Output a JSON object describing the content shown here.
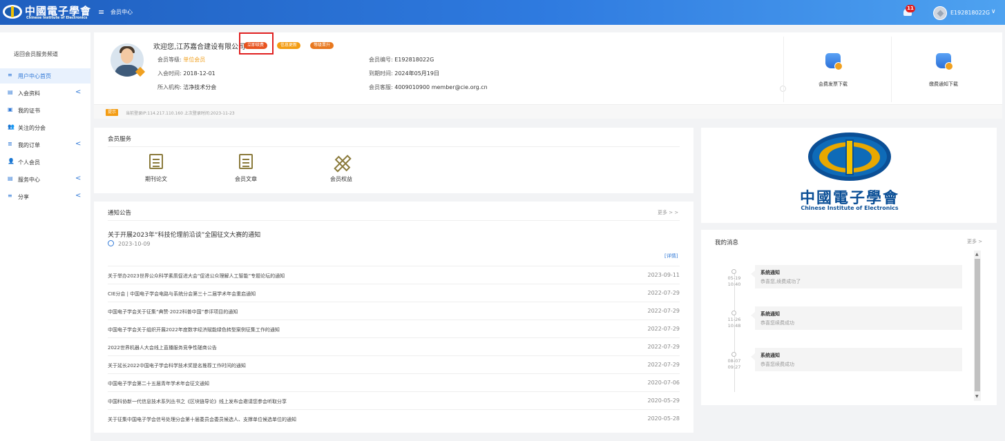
{
  "topbar": {
    "logo_cn": "中國電子學會",
    "logo_en": "Chinese Institute of Electronics",
    "menu_glyph": "≡",
    "breadcrumb": "会员中心",
    "notification_count": "11",
    "user_id": "E192818022G",
    "caret": "∨"
  },
  "sidebar": {
    "back_label": "返回会员服务频道",
    "items": [
      {
        "label": "用户中心首页",
        "icon": "≡",
        "active": true
      },
      {
        "label": "入会资料",
        "icon": "▤",
        "caret": "<"
      },
      {
        "label": "我的证书",
        "icon": "▣"
      },
      {
        "label": "关注的分会",
        "icon": "👥"
      },
      {
        "label": "我的订单",
        "icon": "≣",
        "caret": "<"
      },
      {
        "label": "个人会员",
        "icon": "👤"
      },
      {
        "label": "服务中心",
        "icon": "▤",
        "caret": "<"
      },
      {
        "label": "分享",
        "icon": "≡",
        "caret": "<"
      }
    ]
  },
  "profile": {
    "welcome": "欢迎您,江苏嘉合建设有限公司",
    "tags": {
      "renew": "立即续费",
      "info": "信息更新",
      "upgrade": "等级晋升"
    },
    "level_label": "会员等级:",
    "level_value": "单位会员",
    "join_label": "入会时间:",
    "join_value": "2018-12-01",
    "org_label": "所入机构:",
    "org_value": "洁净技术分会",
    "id_label": "会员编号:",
    "id_value": "E192818022G",
    "expire_label": "到期时间:",
    "expire_value": "2024年05月19日",
    "service_label": "会员客服:",
    "service_value": "4009010900    member@cie.org.cn",
    "tip_badge": "提示",
    "tip_text": "当前登录IP:114.217.110.160      上次登录时间:2023-11-23",
    "downloads": [
      "会费发票下载",
      "缴费通知下载"
    ]
  },
  "services": {
    "title": "会员服务",
    "items": [
      "期刊论文",
      "会员文章",
      "会员权益"
    ]
  },
  "notices": {
    "title": "通知公告",
    "more": "更多 > >",
    "featured_title": "关于开展2023年“科技伦理前沿谈”全国征文大赛的通知",
    "featured_date": "2023-10-09",
    "detail": "[详情]",
    "rows": [
      {
        "title": "关于举办2023世界公众科学素质促进大会“促进公众理解人工智能”专题论坛的通知",
        "date": "2023-09-11"
      },
      {
        "title": "CIE分会 | 中国电子学会电路与系统分会第三十二届学术年会重启通知",
        "date": "2022-07-29"
      },
      {
        "title": "中国电子学会关于征集“典赞·2022科普中国”参评项目的通知",
        "date": "2022-07-29"
      },
      {
        "title": "中国电子学会关于组织开展2022年度数字经济赋能绿色转型案例征集工作的通知",
        "date": "2022-07-29"
      },
      {
        "title": "2022世界机器人大会线上直播服务竞争性磋商公告",
        "date": "2022-07-29"
      },
      {
        "title": "关于延长2022中国电子学会科学技术奖提名推荐工作时间的通知",
        "date": "2022-07-29"
      },
      {
        "title": "中国电子学会第二十五届青年学术年会征文通知",
        "date": "2020-07-06"
      },
      {
        "title": "中国科协新一代信息技术系列丛书之《区块链导论》线上发布会邀请您参会听取分享",
        "date": "2020-05-29"
      },
      {
        "title": "关于征集中国电子学会信号处理分会第十届委员会委员候选人、支撑单位候选单位的通知",
        "date": "2020-05-28"
      }
    ]
  },
  "banner": {
    "cn": "中國電子學會",
    "en": "Chinese Institute of Electronics"
  },
  "messages": {
    "title": "我的消息",
    "more": "更多 >",
    "arrow_up": "▲",
    "arrow_down": "▼",
    "items": [
      {
        "date": "05-19",
        "time": "10:40",
        "type": "系统通知",
        "body": "恭喜您,续费成功了"
      },
      {
        "date": "11-26",
        "time": "10:48",
        "type": "系统通知",
        "body": "恭喜您续费成功"
      },
      {
        "date": "08-07",
        "time": "09:27",
        "type": "系统通知",
        "body": "恭喜您续费成功"
      }
    ]
  }
}
